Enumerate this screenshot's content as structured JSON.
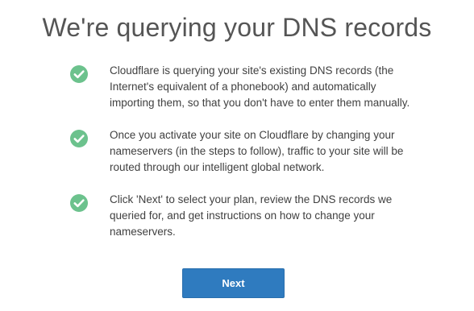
{
  "page": {
    "title": "We're querying your DNS records"
  },
  "steps": [
    {
      "icon": "check-circle-icon",
      "text": "Cloudflare is querying your site's existing DNS records (the Internet's equivalent of a phonebook) and automatically importing them, so that you don't have to enter them manually."
    },
    {
      "icon": "check-circle-icon",
      "text": "Once you activate your site on Cloudflare by changing your nameservers (in the steps to follow), traffic to your site will be routed through our intelligent global network."
    },
    {
      "icon": "check-circle-icon",
      "text": "Click 'Next' to select your plan, review the DNS records we queried for, and get instructions on how to change your nameservers."
    }
  ],
  "actions": {
    "next_label": "Next"
  },
  "colors": {
    "check_green": "#6cc28d",
    "button_blue": "#2f7bbf",
    "title_gray": "#555555"
  }
}
